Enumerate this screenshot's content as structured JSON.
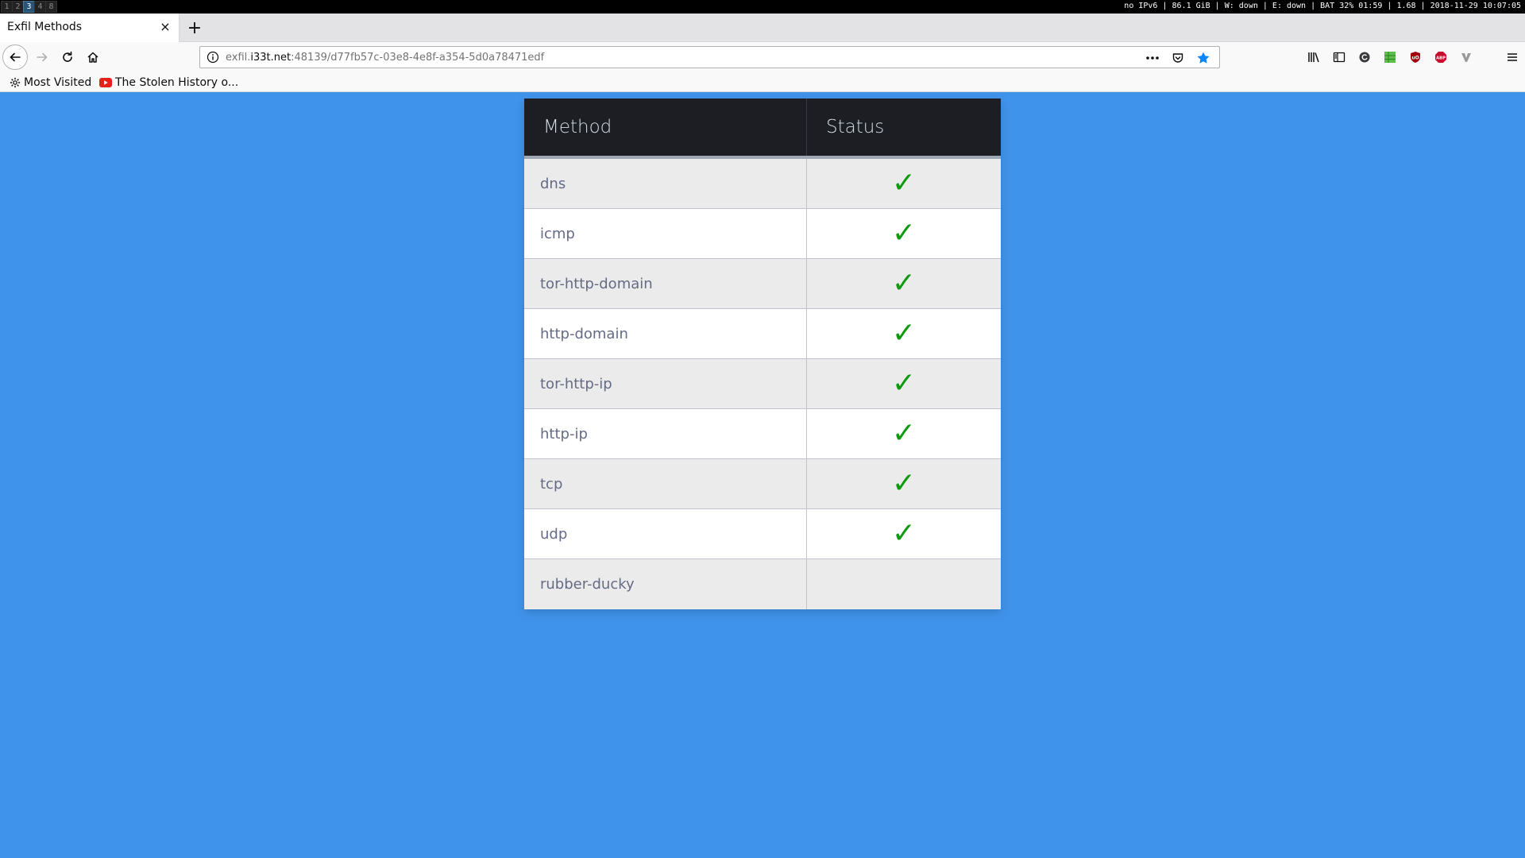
{
  "i3bar": {
    "workspaces": [
      {
        "label": "1",
        "active": false
      },
      {
        "label": "2",
        "active": false
      },
      {
        "label": "3",
        "active": true
      },
      {
        "label": "4",
        "active": false
      },
      {
        "label": "8",
        "active": false
      }
    ],
    "status": "no IPv6 | 86.1 GiB | W: down | E: down | BAT 32% 01:59 | 1.68 | 2018-11-29 10:07:05"
  },
  "browser": {
    "tab_title": "Exfil Methods",
    "tab_close": "×",
    "new_tab": "+",
    "url_prefix": "exfil.",
    "url_domain": "i33t.net",
    "url_rest": ":48139/d77fb57c-03e8-4e8f-a354-5d0a78471edf",
    "bookmarks": [
      {
        "label": "Most Visited",
        "icon": "gear-icon"
      },
      {
        "label": "The Stolen History o...",
        "icon": "youtube-icon"
      }
    ]
  },
  "table": {
    "headers": {
      "method": "Method",
      "status": "Status"
    },
    "rows": [
      {
        "method": "dns",
        "status": "✓"
      },
      {
        "method": "icmp",
        "status": "✓"
      },
      {
        "method": "tor-http-domain",
        "status": "✓"
      },
      {
        "method": "http-domain",
        "status": "✓"
      },
      {
        "method": "tor-http-ip",
        "status": "✓"
      },
      {
        "method": "http-ip",
        "status": "✓"
      },
      {
        "method": "tcp",
        "status": "✓"
      },
      {
        "method": "udp",
        "status": "✓"
      },
      {
        "method": "rubber-ducky",
        "status": ""
      }
    ]
  },
  "colors": {
    "page_bg": "#4093ea",
    "header_bg": "#1c1e23",
    "check": "#0e9a0e"
  }
}
